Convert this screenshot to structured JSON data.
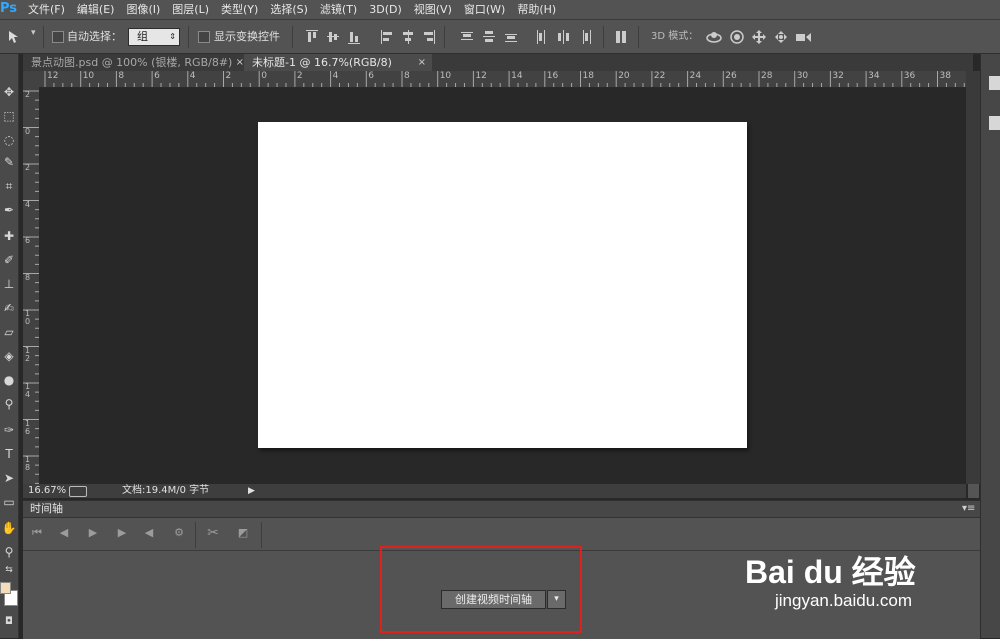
{
  "app": {
    "logo": "Ps"
  },
  "menu": [
    "文件(F)",
    "编辑(E)",
    "图像(I)",
    "图层(L)",
    "类型(Y)",
    "选择(S)",
    "滤镜(T)",
    "3D(D)",
    "视图(V)",
    "窗口(W)",
    "帮助(H)"
  ],
  "options": {
    "move_tool_icon": "move-arrow-icon",
    "auto_select_label": "自动选择：",
    "auto_select_value": "组",
    "show_transform_label": "显示变换控件",
    "mode3d_label": "3D 模式："
  },
  "tabs": [
    {
      "label": "景点动图.psd @ 100% (银楼, RGB/8#)",
      "close": "×"
    },
    {
      "label": "未标题-1 @ 16.7%(RGB/8)",
      "close": "×"
    }
  ],
  "ruler": {
    "h": [
      "12",
      "10",
      "8",
      "6",
      "4",
      "2",
      "0",
      "2",
      "4",
      "6",
      "8",
      "10",
      "12",
      "14",
      "16",
      "18",
      "20",
      "22",
      "24",
      "26",
      "28",
      "30",
      "32",
      "34",
      "36",
      "38"
    ],
    "v": [
      "2",
      "0",
      "2",
      "4",
      "6",
      "8",
      "10",
      "12",
      "14",
      "16",
      "18"
    ]
  },
  "status": {
    "zoom": "16.67%",
    "doc": "文档:19.4M/0 字节",
    "arrow": "▶"
  },
  "timeline": {
    "title": "时间轴",
    "menu": "▾≡",
    "create_button": "创建视频时间轴",
    "dropdown": "▾"
  },
  "watermark": {
    "brand": "Bai du 经验",
    "url": "jingyan.baidu.com"
  },
  "colors": {
    "foreground": "#f3dcb8",
    "background": "#ffffff",
    "highlight": "#e0201a"
  }
}
